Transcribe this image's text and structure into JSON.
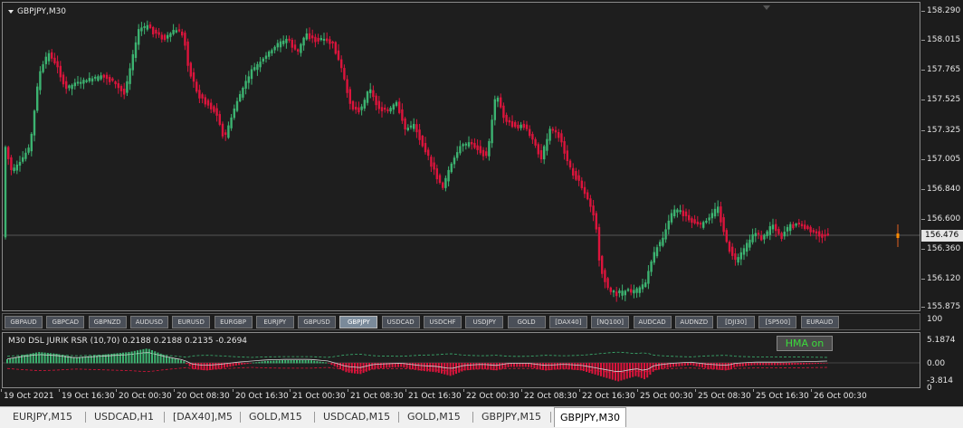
{
  "chart": {
    "title": "GBPJPY,M30",
    "current_price": "156.476",
    "price_labels": [
      "158.290",
      "158.015",
      "157.765",
      "157.525",
      "157.325",
      "157.005",
      "156.840",
      "156.600",
      "156.360",
      "156.120",
      "155.875"
    ],
    "time_labels": [
      "19 Oct 2021",
      "19 Oct 16:30",
      "20 Oct 00:30",
      "20 Oct 08:30",
      "20 Oct 16:30",
      "21 Oct 00:30",
      "21 Oct 08:30",
      "21 Oct 16:30",
      "22 Oct 00:30",
      "22 Oct 08:30",
      "22 Oct 16:30",
      "25 Oct 00:30",
      "25 Oct 08:30",
      "25 Oct 16:30",
      "26 Oct 00:30"
    ],
    "colors": {
      "bull": "#3cb371",
      "bear": "#dc143c",
      "background": "#1e1e1e"
    }
  },
  "symbol_buttons": [
    "GBPAUD",
    "GBPCAD",
    "GBPNZD",
    "AUDUSD",
    "EURUSD",
    "EURGBP",
    "EURJPY",
    "GBPUSD",
    "GBPJPY",
    "USDCAD",
    "USDCHF",
    "USDJPY",
    "GOLD",
    "[DAX40]",
    "[NQ100]",
    "AUDCAD",
    "AUDNZD",
    "[DJI30]",
    "[SP500]",
    "EURAUD"
  ],
  "active_symbol": "GBPJPY",
  "indicator": {
    "title": "M30 DSL JURIK RSR (10,70) 0.2188 0.2188 0.2135 -0.2694",
    "hma_button": "HMA on",
    "axis_labels": [
      "100",
      "5.1874",
      "0.00",
      "-3.814",
      "0"
    ]
  },
  "tabs": [
    "EURJPY,M15",
    "USDCAD,H1",
    "[DAX40],M5",
    "GOLD,M15",
    "USDCAD,M15",
    "GOLD,M15",
    "GBPJPY,M15",
    "GBPJPY,M30"
  ],
  "active_tab": "GBPJPY,M30"
}
